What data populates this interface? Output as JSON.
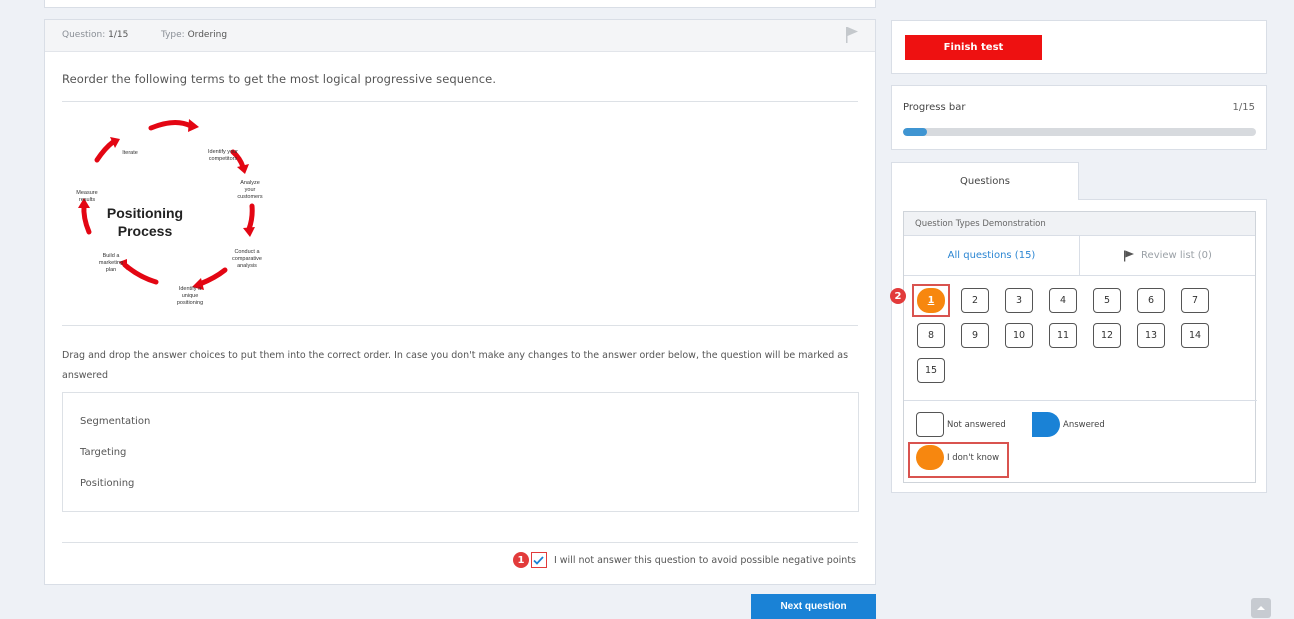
{
  "question": {
    "number_label": "Question:",
    "number": "1/15",
    "type_label": "Type:",
    "type": "Ordering",
    "text": "Reorder the following terms to get the most logical progressive sequence.",
    "instructions": "Drag and drop the answer choices to put them into the correct order. In case you don't make any changes to the answer order below, the question will be marked as answered",
    "answers": [
      "Segmentation",
      "Targeting",
      "Positioning"
    ],
    "skip_label": "I will not answer this question to avoid possible negative points",
    "skip_checked": true,
    "skip_badge": "1"
  },
  "diagram": {
    "center_line1": "Positioning",
    "center_line2": "Process",
    "steps": [
      [
        "Identify your",
        "competitors"
      ],
      [
        "Analyze",
        "your",
        "customers"
      ],
      [
        "Conduct a",
        "comparative",
        "analysis"
      ],
      [
        "Identify a",
        "unique",
        "positioning"
      ],
      [
        "Build a",
        "marketing",
        "plan"
      ],
      [
        "Measure",
        "results"
      ],
      [
        "Iterate"
      ]
    ],
    "arrow_color": "#e30613"
  },
  "next_button": "Next question",
  "sidebar": {
    "finish_button": "Finish test",
    "progress": {
      "label": "Progress bar",
      "count": "1/15",
      "fraction": 0.0667
    },
    "tab_label": "Questions",
    "panel_title": "Question Types Demonstration",
    "filter_all": "All questions (15)",
    "filter_review": "Review list (0)",
    "numbers": [
      "1",
      "2",
      "3",
      "4",
      "5",
      "6",
      "7",
      "8",
      "9",
      "10",
      "11",
      "12",
      "13",
      "14",
      "15"
    ],
    "current_badge": "2",
    "legend": {
      "not_answered": "Not answered",
      "answered": "Answered",
      "dont_know": "I don't know"
    }
  },
  "colors": {
    "accent_blue": "#1a82d6",
    "finish_red": "#ee1111",
    "dont_know_orange": "#f7870f",
    "annotation_red": "#d9534f"
  }
}
